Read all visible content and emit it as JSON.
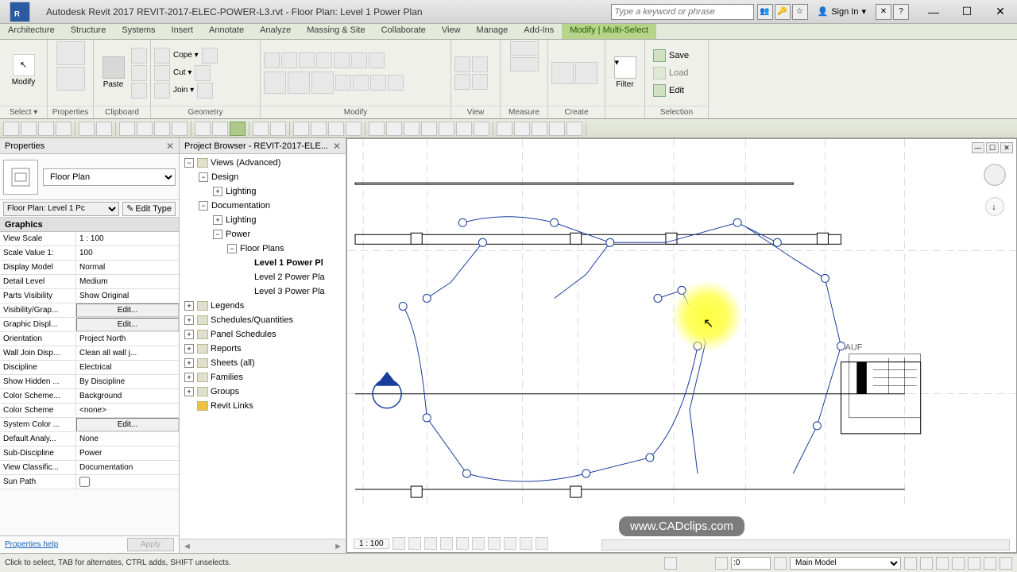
{
  "title": "Autodesk Revit 2017       REVIT-2017-ELEC-POWER-L3.rvt - Floor Plan: Level 1 Power Plan",
  "search_placeholder": "Type a keyword or phrase",
  "signin": "Sign In",
  "ribbon_tabs": [
    "Architecture",
    "Structure",
    "Systems",
    "Insert",
    "Annotate",
    "Analyze",
    "Massing & Site",
    "Collaborate",
    "View",
    "Manage",
    "Add-Ins",
    "Modify | Multi-Select"
  ],
  "ribbon": {
    "select": {
      "modify": "Modify",
      "title": "Select ▾",
      "props": "Properties"
    },
    "clipboard": {
      "paste": "Paste",
      "title": "Clipboard"
    },
    "geometry": {
      "cope": "Cope ▾",
      "cut": "Cut ▾",
      "join": "Join ▾",
      "title": "Geometry"
    },
    "modify": {
      "title": "Modify"
    },
    "view": {
      "title": "View"
    },
    "measure": {
      "title": "Measure"
    },
    "create": {
      "title": "Create"
    },
    "filter": {
      "label": "Filter",
      "title": ""
    },
    "selection": {
      "save": "Save",
      "load": "Load",
      "edit": "Edit",
      "title": "Selection"
    }
  },
  "properties": {
    "title": "Properties",
    "type": "Floor Plan",
    "instance": "Floor Plan: Level 1 Pc",
    "edit_type": "Edit Type",
    "category": "Graphics",
    "rows": [
      {
        "label": "View Scale",
        "value": "1 : 100"
      },
      {
        "label": "Scale Value   1:",
        "value": "100"
      },
      {
        "label": "Display Model",
        "value": "Normal"
      },
      {
        "label": "Detail Level",
        "value": "Medium"
      },
      {
        "label": "Parts Visibility",
        "value": "Show Original"
      },
      {
        "label": "Visibility/Grap...",
        "value": "Edit...",
        "btn": true
      },
      {
        "label": "Graphic Displ...",
        "value": "Edit...",
        "btn": true
      },
      {
        "label": "Orientation",
        "value": "Project North"
      },
      {
        "label": "Wall Join Disp...",
        "value": "Clean all wall j..."
      },
      {
        "label": "Discipline",
        "value": "Electrical"
      },
      {
        "label": "Show Hidden ...",
        "value": "By Discipline"
      },
      {
        "label": "Color Scheme...",
        "value": "Background"
      },
      {
        "label": "Color Scheme",
        "value": "<none>"
      },
      {
        "label": "System Color ...",
        "value": "Edit...",
        "btn": true
      },
      {
        "label": "Default Analy...",
        "value": "None"
      },
      {
        "label": "Sub-Discipline",
        "value": "Power"
      },
      {
        "label": "View Classific...",
        "value": "Documentation"
      },
      {
        "label": "Sun Path",
        "value": "",
        "checkbox": true
      }
    ],
    "help": "Properties help",
    "apply": "Apply"
  },
  "browser": {
    "title": "Project Browser - REVIT-2017-ELE...",
    "tree": [
      {
        "depth": 0,
        "toggle": "−",
        "icon": true,
        "label": "Views (Advanced)"
      },
      {
        "depth": 1,
        "toggle": "−",
        "label": "Design"
      },
      {
        "depth": 2,
        "toggle": "+",
        "label": "Lighting"
      },
      {
        "depth": 1,
        "toggle": "−",
        "label": "Documentation"
      },
      {
        "depth": 2,
        "toggle": "+",
        "label": "Lighting"
      },
      {
        "depth": 2,
        "toggle": "−",
        "label": "Power"
      },
      {
        "depth": 3,
        "toggle": "−",
        "label": "Floor Plans"
      },
      {
        "depth": 4,
        "label": "Level 1 Power Pl",
        "bold": true
      },
      {
        "depth": 4,
        "label": "Level 2 Power Pla"
      },
      {
        "depth": 4,
        "label": "Level 3 Power Pla"
      },
      {
        "depth": 0,
        "toggle": "+",
        "icon": true,
        "label": "Legends"
      },
      {
        "depth": 0,
        "toggle": "+",
        "icon": true,
        "label": "Schedules/Quantities"
      },
      {
        "depth": 0,
        "toggle": "+",
        "icon": true,
        "label": "Panel Schedules"
      },
      {
        "depth": 0,
        "toggle": "+",
        "icon": true,
        "label": "Reports"
      },
      {
        "depth": 0,
        "toggle": "+",
        "icon": true,
        "label": "Sheets (all)"
      },
      {
        "depth": 0,
        "toggle": "+",
        "icon": true,
        "label": "Families"
      },
      {
        "depth": 0,
        "toggle": "+",
        "icon": true,
        "label": "Groups"
      },
      {
        "depth": 0,
        "icon": true,
        "linkicon": true,
        "label": "Revit Links"
      }
    ]
  },
  "canvas": {
    "auf_label": "AUF",
    "watermark": "www.CADclips.com",
    "scale": "1 : 100"
  },
  "status": {
    "hint": "Click to select, TAB for alternates, CTRL adds, SHIFT unselects.",
    "sel_count": ":0",
    "workset": "Main Model"
  }
}
